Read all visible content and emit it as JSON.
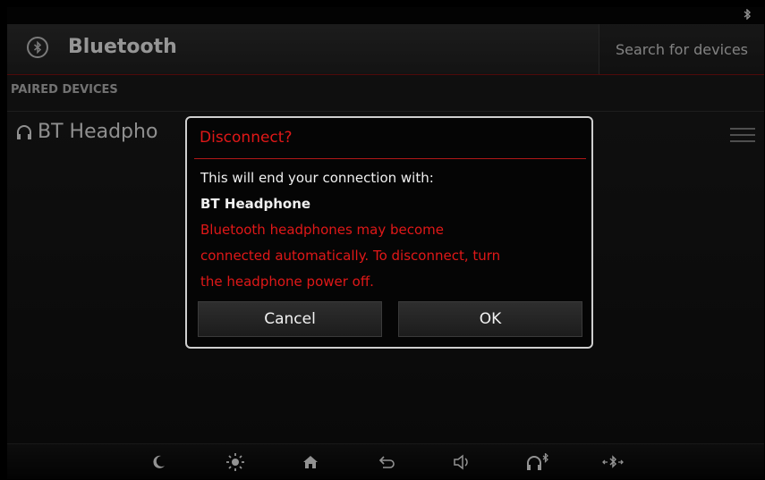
{
  "status": {
    "bluetooth_glyph": "ʙ"
  },
  "header": {
    "title": "Bluetooth",
    "search_label": "Search for devices"
  },
  "section": {
    "label": "PAIRED DEVICES"
  },
  "device": {
    "name": "BT Headpho"
  },
  "dialog": {
    "title": "Disconnect?",
    "line1": "This will end your connection with:",
    "device": "BT Headphone",
    "warning_line1": "Bluetooth headphones may become",
    "warning_line2": "connected automatically. To disconnect, turn",
    "warning_line3": "the headphone power off.",
    "cancel_label": "Cancel",
    "ok_label": "OK"
  },
  "dock": {
    "icons": [
      "moon-icon",
      "brightness-icon",
      "home-icon",
      "back-icon",
      "volume-icon",
      "bt-audio-icon",
      "bt-connect-icon"
    ]
  },
  "colors": {
    "accent": "#e01818",
    "divider": "#7a1010"
  }
}
